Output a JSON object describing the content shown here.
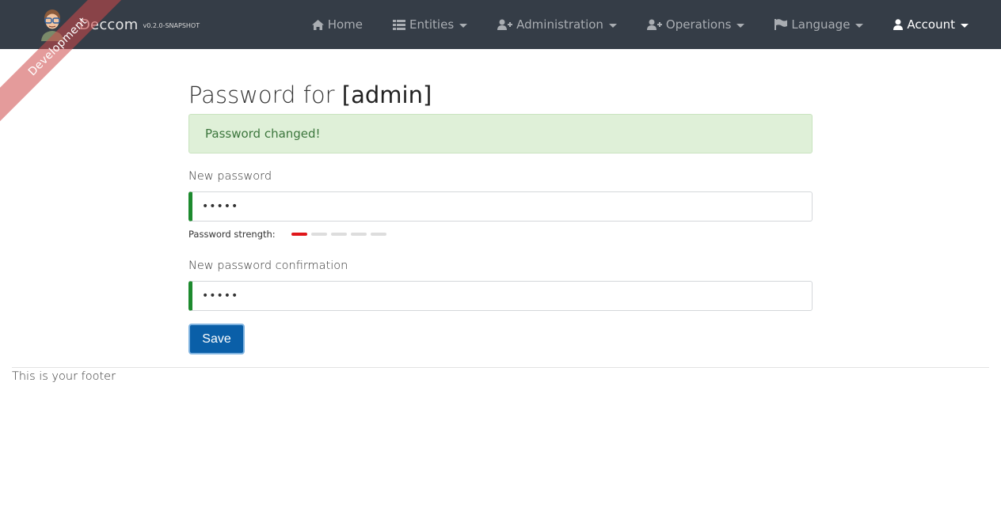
{
  "navbar": {
    "brand_title": "Deccom",
    "brand_version": "v0.2.0-SNAPSHOT",
    "ribbon_text": "Development",
    "items": [
      {
        "label": "Home",
        "icon": "home-icon",
        "dropdown": false
      },
      {
        "label": "Entities",
        "icon": "list-icon",
        "dropdown": true
      },
      {
        "label": "Administration",
        "icon": "user-plus-icon",
        "dropdown": true
      },
      {
        "label": "Operations",
        "icon": "user-plus-icon",
        "dropdown": true
      },
      {
        "label": "Language",
        "icon": "flag-icon",
        "dropdown": true
      },
      {
        "label": "Account",
        "icon": "user-icon",
        "dropdown": true,
        "active": true
      }
    ],
    "colors": {
      "background": "#353d47",
      "item": "#a9adb2",
      "active": "#ffffff"
    }
  },
  "page": {
    "title_prefix": "Password for ",
    "title_login": "[admin]",
    "alert_success": "Password changed!",
    "new_password_label": "New password",
    "new_password_value": "12345",
    "strength_label": "Password strength:",
    "strength_level": 1,
    "strength_max": 5,
    "confirm_password_label": "New password confirmation",
    "confirm_password_value": "12345",
    "save_label": "Save"
  },
  "footer": {
    "text": "This is your footer"
  },
  "colors": {
    "alert_bg": "#dff0d8",
    "alert_text": "#3c763d",
    "valid_border": "#1d8a2e",
    "strength_on": "#e0161a",
    "strength_off": "#dddddd",
    "primary_button": "#0a5fa8"
  }
}
